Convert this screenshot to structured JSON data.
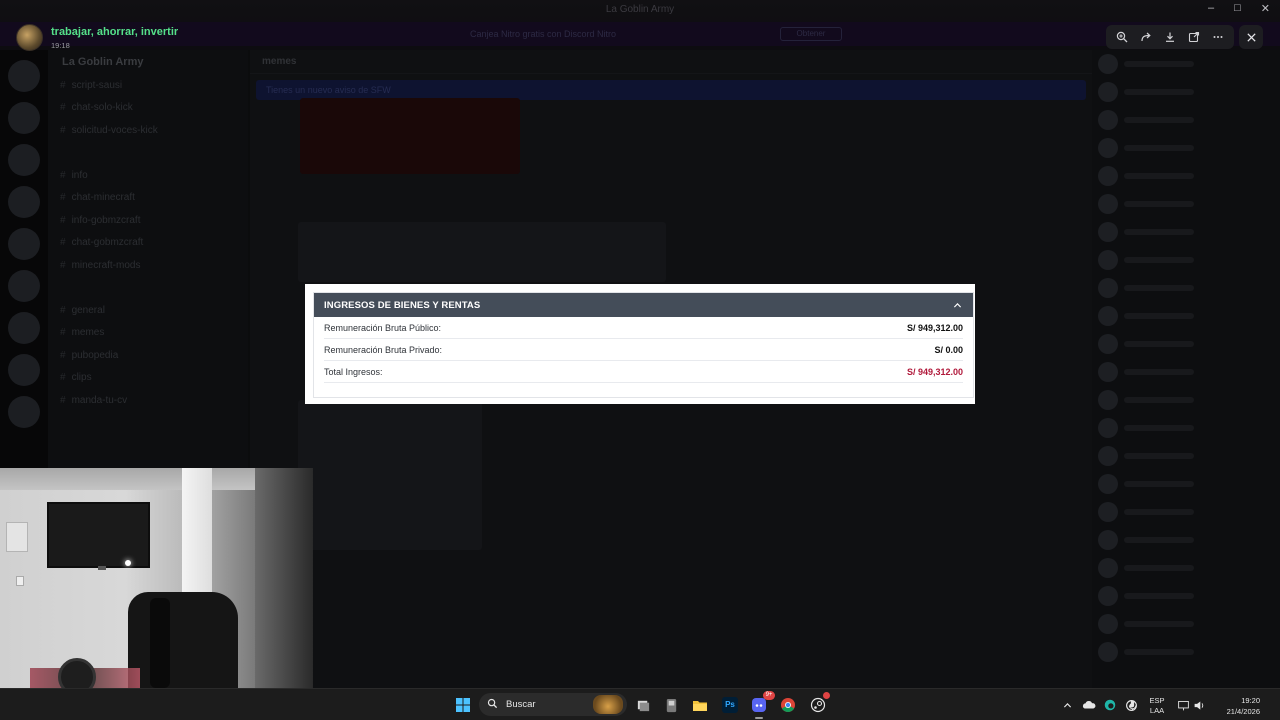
{
  "window": {
    "title": "La Goblin Army",
    "controls": [
      "–",
      "□",
      "✕"
    ]
  },
  "viewer": {
    "user_name": "trabajar, ahorrar, invertir",
    "timestamp": "19:18",
    "tools": [
      "zoom-in-icon",
      "forward-icon",
      "download-icon",
      "open-external-icon",
      "more-icon"
    ],
    "close_icon": "close-icon"
  },
  "background": {
    "banner_text": "Canjea Nitro gratis con Discord Nitro",
    "banner_button": "Obtener",
    "guild_name": "La Goblin Army",
    "channel_header": "memes",
    "notice": "Tienes un nuevo aviso de SFW",
    "channels": [
      "script-sausi",
      "chat-solo-kick",
      "solicitud-voces-kick",
      "info",
      "chat-minecraft",
      "info-gobmzcraft",
      "chat-gobmzcraft",
      "minecraft-mods",
      "general",
      "memes",
      "pubopedia",
      "clips",
      "manda-tu-cv"
    ]
  },
  "modal": {
    "section_title": "INGRESOS DE BIENES Y RENTAS",
    "collapse_icon": "chevron-up-icon",
    "rows": [
      {
        "label": "Remuneración Bruta Público:",
        "value": "S/ 949,312.00"
      },
      {
        "label": "Remuneración Bruta Privado:",
        "value": "S/ 0.00"
      },
      {
        "label": "Total Ingresos:",
        "value": "S/ 949,312.00"
      }
    ],
    "colors": {
      "header": "#444d59",
      "total": "#b0183a"
    }
  },
  "taskbar": {
    "search_placeholder": "Buscar",
    "apps": [
      "windows-start-icon",
      "search-icon",
      "task-view-icon",
      "terminal-icon",
      "file-explorer-icon",
      "photoshop-icon",
      "discord-icon",
      "chrome-icon",
      "steam-icon"
    ],
    "photoshop_label": "Ps",
    "discord_badge": "9+",
    "language": "ESP",
    "language_sub": "LAA",
    "time": "19:20",
    "date": "21/4/2026"
  }
}
